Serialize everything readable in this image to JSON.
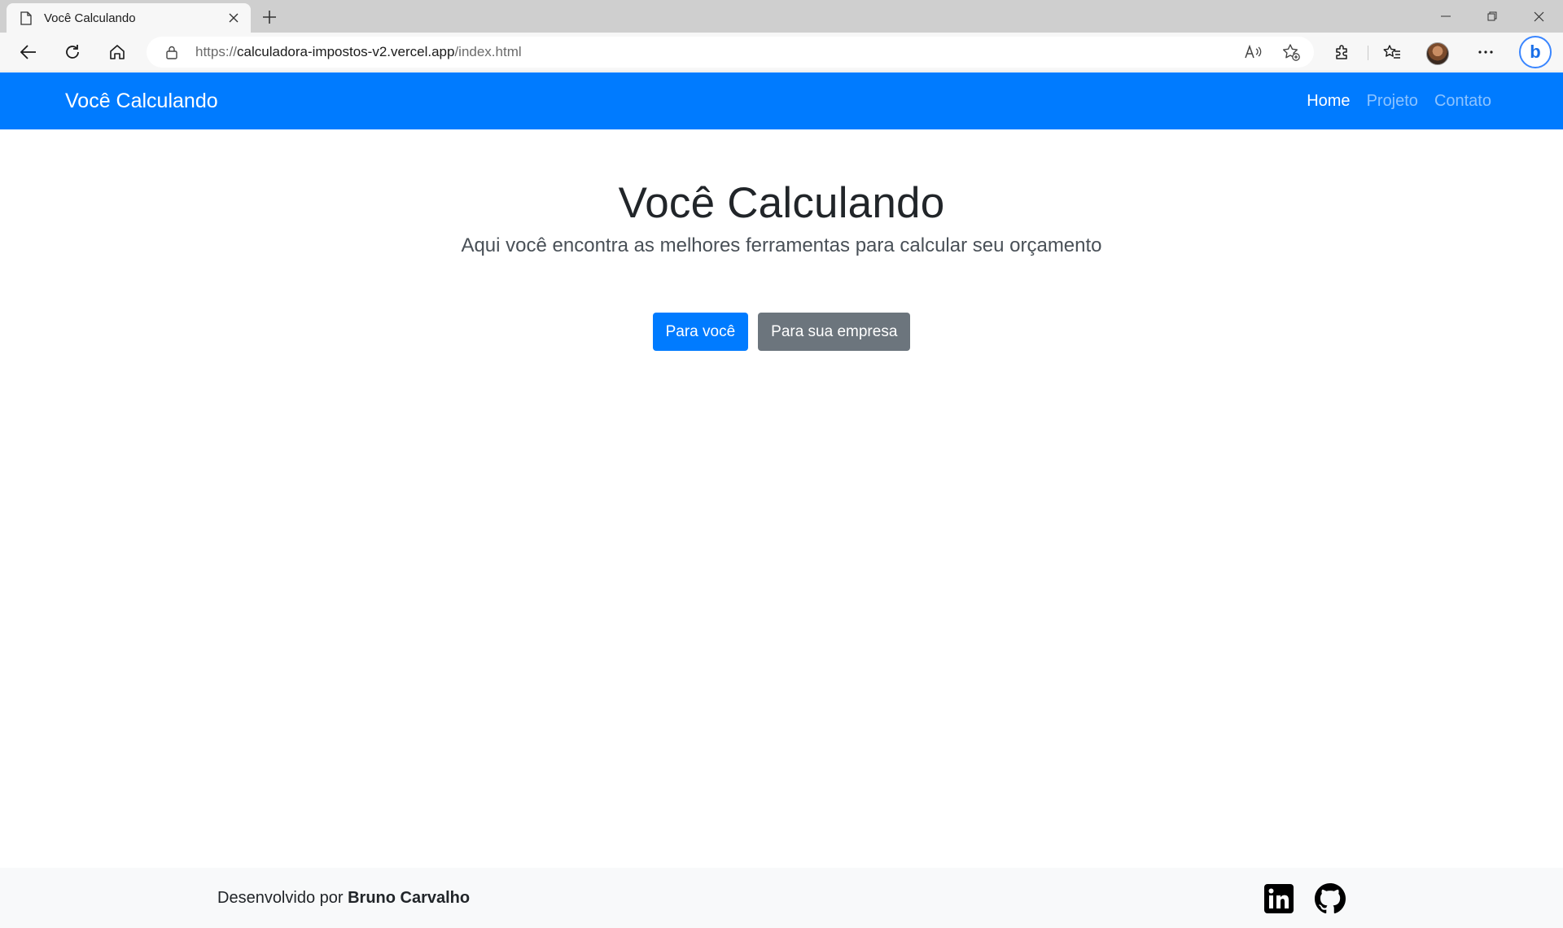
{
  "browser": {
    "tab_title": "Você Calculando",
    "url_scheme": "https://",
    "url_host": "calculadora-impostos-v2.vercel.app",
    "url_path": "/index.html"
  },
  "icons": {
    "tab": "page-icon",
    "tab_close": "close-icon",
    "new_tab": "plus-icon",
    "minimize": "minimize-icon",
    "restore": "restore-icon",
    "window_close": "close-icon",
    "back": "back-arrow-icon",
    "refresh": "refresh-icon",
    "home": "home-icon",
    "lock": "lock-icon",
    "read_aloud": "read-aloud-icon",
    "add_favorite": "star-plus-icon",
    "extensions": "puzzle-icon",
    "favorites": "favorites-icon",
    "more": "more-icon",
    "bing": "bing-icon",
    "linkedin": "linkedin-icon",
    "github": "github-icon"
  },
  "navbar": {
    "brand": "Você Calculando",
    "links": [
      {
        "label": "Home",
        "active": true
      },
      {
        "label": "Projeto",
        "active": false
      },
      {
        "label": "Contato",
        "active": false
      }
    ]
  },
  "hero": {
    "title": "Você Calculando",
    "subtitle": "Aqui você encontra as melhores ferramentas para calcular seu orçamento",
    "primary_button": "Para você",
    "secondary_button": "Para sua empresa"
  },
  "footer": {
    "prefix": "Desenvolvido por",
    "author": "Bruno Carvalho"
  },
  "colors": {
    "brand_blue": "#007bff",
    "secondary_gray": "#6c757d",
    "footer_bg": "#f8f9fa"
  }
}
